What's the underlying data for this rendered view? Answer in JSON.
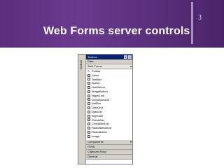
{
  "slide": {
    "title": "Web Forms server controls",
    "number": "3"
  },
  "toolbox": {
    "title": "Toolbox",
    "side_tab": "Toolbox",
    "sections_top": [
      "Data",
      "Web Forms"
    ],
    "items": [
      {
        "label": "Pointer",
        "icon": "pointer-icon"
      },
      {
        "label": "Label",
        "icon": "label-icon"
      },
      {
        "label": "TextBox",
        "icon": "textbox-icon"
      },
      {
        "label": "Button",
        "icon": "button-icon"
      },
      {
        "label": "LinkButton",
        "icon": "linkbutton-icon"
      },
      {
        "label": "ImageButton",
        "icon": "imagebutton-icon"
      },
      {
        "label": "HyperLink",
        "icon": "hyperlink-icon"
      },
      {
        "label": "DropDownList",
        "icon": "dropdownlist-icon"
      },
      {
        "label": "ListBox",
        "icon": "listbox-icon"
      },
      {
        "label": "DataGrid",
        "icon": "datagrid-icon"
      },
      {
        "label": "DataList",
        "icon": "datalist-icon"
      },
      {
        "label": "Repeater",
        "icon": "repeater-icon"
      },
      {
        "label": "CheckBox",
        "icon": "checkbox-icon"
      },
      {
        "label": "CheckBoxList",
        "icon": "checkboxlist-icon"
      },
      {
        "label": "RadioButtonList",
        "icon": "radiobuttonlist-icon"
      },
      {
        "label": "RadioButton",
        "icon": "radiobutton-icon"
      },
      {
        "label": "Image",
        "icon": "image-icon"
      }
    ],
    "sections_bottom": [
      "Components",
      "HTML",
      "Clipboard Ring",
      "General"
    ]
  },
  "colors": {
    "banner": "#5b2e7c",
    "titlebar": "#0a246a",
    "window": "#d4d0c8"
  }
}
